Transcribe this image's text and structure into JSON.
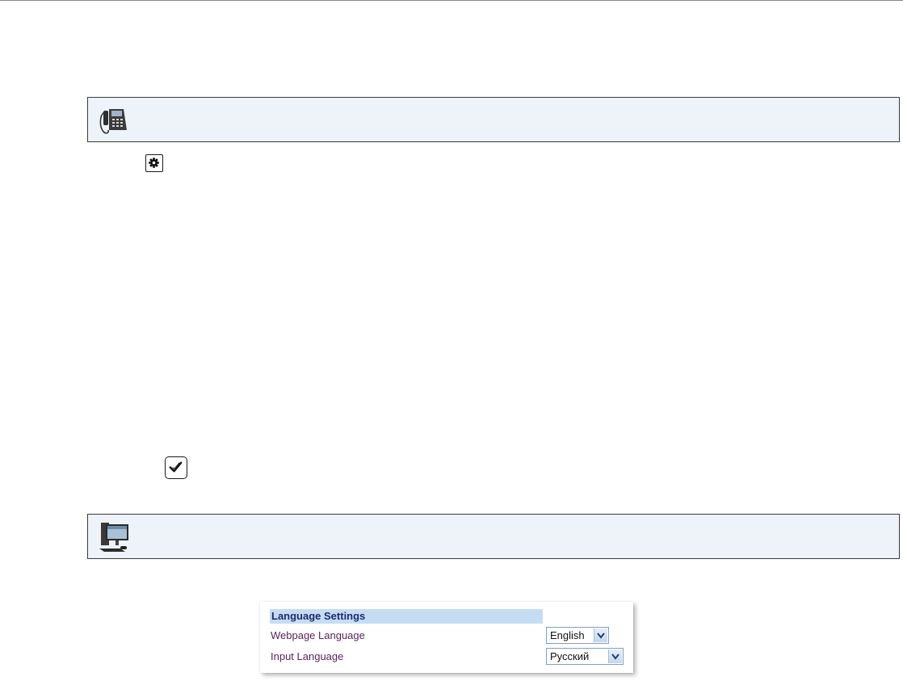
{
  "icons": {
    "phone_banner": "desk-phone-icon",
    "gear_step": "gear-icon",
    "check_step": "checkmark-icon",
    "pc_banner": "desktop-computer-icon"
  },
  "colors": {
    "banner_bg": "#edf3f9",
    "settings_header_bg": "#c5ddf3",
    "settings_header_text": "#1f2a6e",
    "label_text": "#5a1f5a"
  },
  "language_settings": {
    "title": "Language Settings",
    "rows": [
      {
        "label": "Webpage Language",
        "value": "English"
      },
      {
        "label": "Input Language",
        "value": "Русский"
      }
    ]
  }
}
